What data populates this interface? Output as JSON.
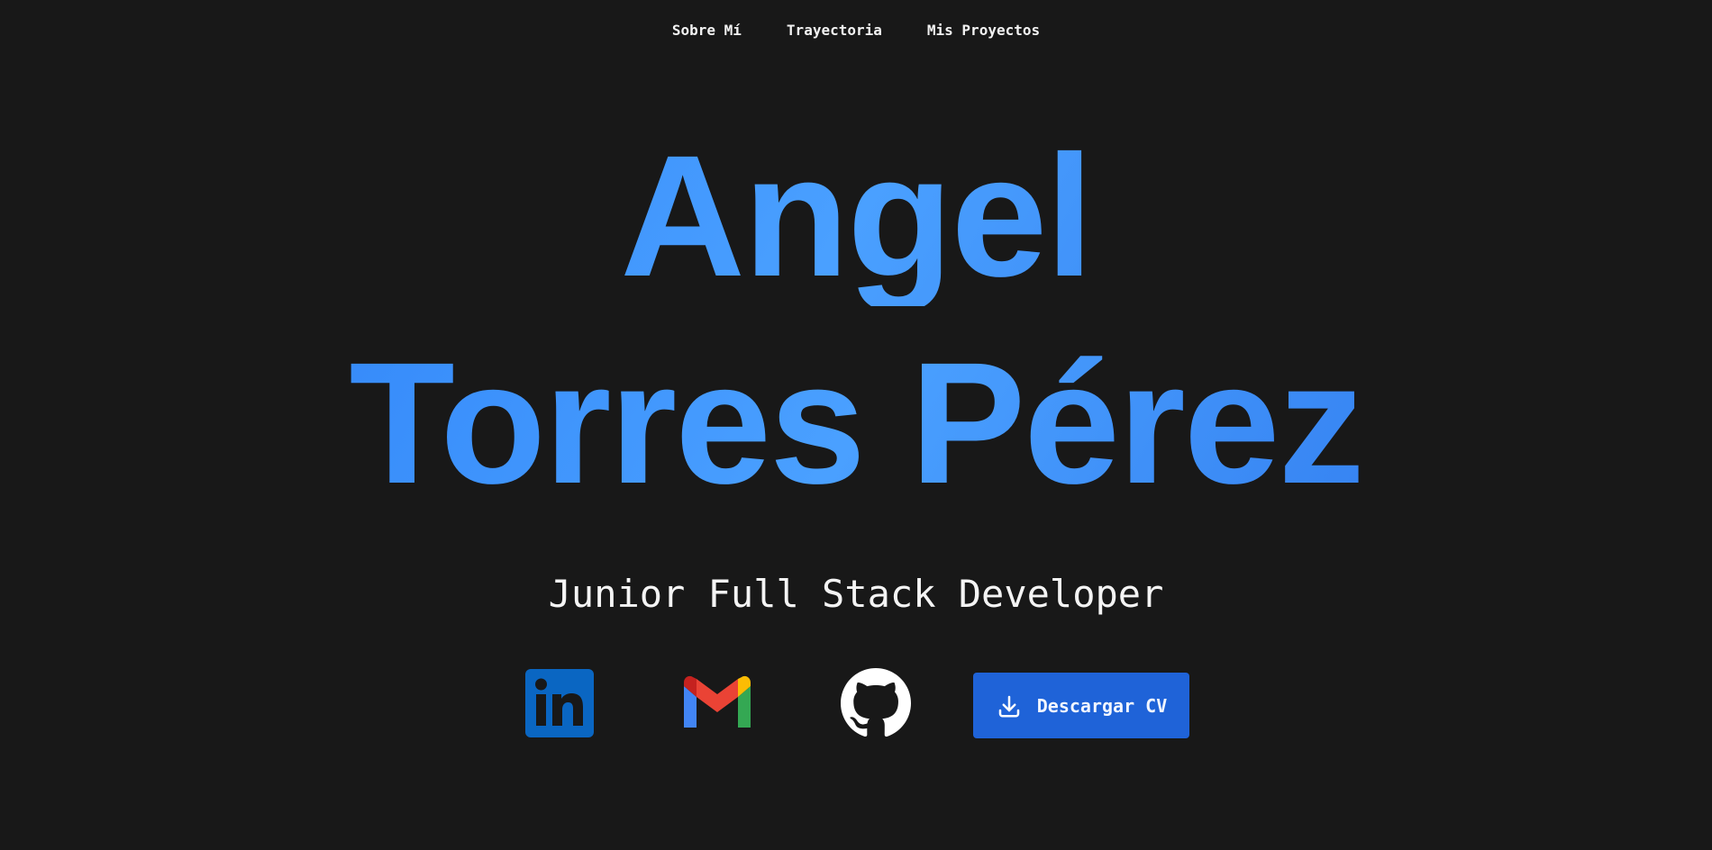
{
  "nav": {
    "items": [
      {
        "label": "Sobre Mí"
      },
      {
        "label": "Trayectoria"
      },
      {
        "label": "Mis Proyectos"
      }
    ]
  },
  "hero": {
    "first_name": "Angel",
    "last_name": "Torres Pérez",
    "role": "Junior Full Stack Developer"
  },
  "social": [
    {
      "icon": "linkedin-icon"
    },
    {
      "icon": "gmail-icon"
    },
    {
      "icon": "github-icon"
    }
  ],
  "cv_button": {
    "label": "Descargar CV",
    "icon": "download-icon"
  },
  "colors": {
    "background": "#181818",
    "accent": "#3a8dfb",
    "button": "#1f63d8",
    "linkedin": "#0a66c2"
  }
}
